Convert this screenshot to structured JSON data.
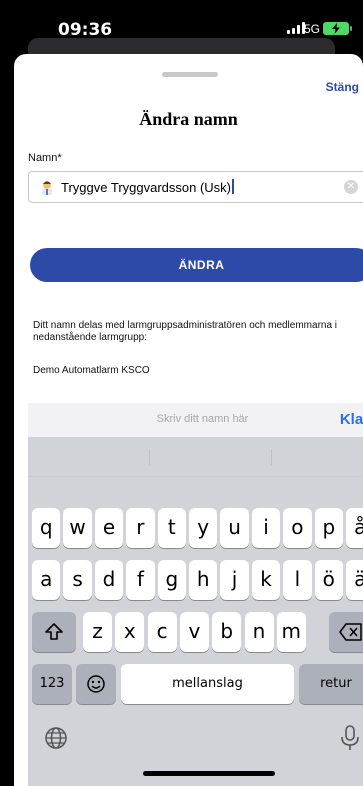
{
  "status": {
    "time": "09:36",
    "network": "5G"
  },
  "sheet": {
    "close_label": "Stäng",
    "title": "Ändra namn",
    "field_label": "Namn*",
    "field_value": "Tryggve Tryggvardsson (Usk)",
    "button_label": "ÄNDRA",
    "info_text": "Ditt namn delas med larmgruppsadministratören och medlemmarna i nedanstående larmgrupp:",
    "group_name": "Demo Automatlarm KSCO"
  },
  "keyboard": {
    "hint": "Skriv ditt namn här",
    "done_label": "Klar",
    "row1": [
      "q",
      "w",
      "e",
      "r",
      "t",
      "y",
      "u",
      "i",
      "o",
      "p",
      "å"
    ],
    "row2": [
      "a",
      "s",
      "d",
      "f",
      "g",
      "h",
      "j",
      "k",
      "l",
      "ö",
      "ä"
    ],
    "row3": [
      "z",
      "x",
      "c",
      "v",
      "b",
      "n",
      "m"
    ],
    "numbers_label": "123",
    "space_label": "mellanslag",
    "return_label": "retur"
  },
  "icons": [
    "signal-icon",
    "battery-charging-icon",
    "emoji-person-icon",
    "clear-icon",
    "shift-icon",
    "backspace-icon",
    "emoji-keyboard-icon",
    "globe-icon",
    "microphone-icon"
  ],
  "colors": {
    "accent": "#2e4aa8",
    "keyboard_done": "#2a6ef0",
    "battery": "#4cd964"
  }
}
